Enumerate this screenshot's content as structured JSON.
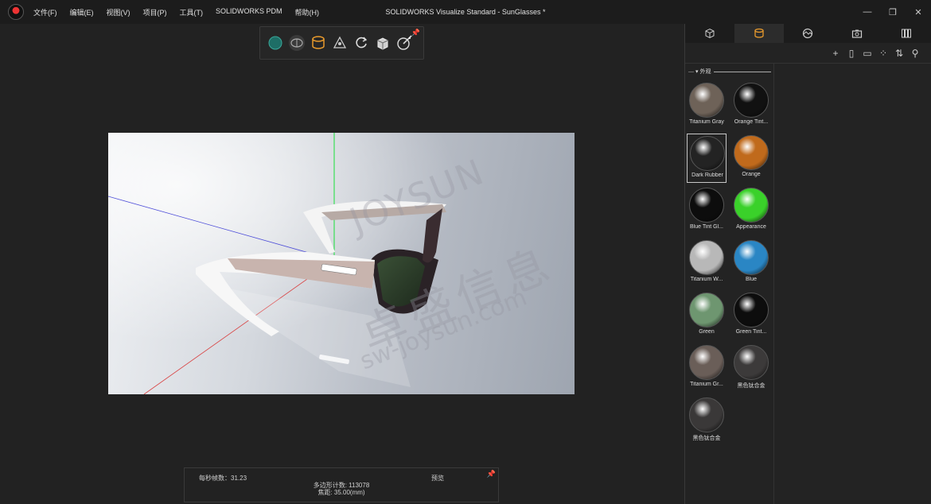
{
  "titlebar": {
    "menu": [
      "文件(F)",
      "编辑(E)",
      "视图(V)",
      "项目(P)",
      "工具(T)",
      "SOLIDWORKS PDM",
      "帮助(H)"
    ],
    "title": "SOLIDWORKS Visualize Standard - SunGlasses *",
    "controls": [
      "—",
      "❐",
      "✕"
    ]
  },
  "viewport": {
    "watermark": [
      "JOYSUN",
      "卓盛信息",
      "sw-joysun.com"
    ]
  },
  "status": {
    "fps": "每秒帧数：31.23",
    "preview": "预览",
    "polycount": "多边形计数: 113078",
    "focal": "焦距: 35.00(mm)"
  },
  "panel": {
    "section_title": "外观",
    "materials": [
      {
        "label": "Titanium Gray",
        "color": "#6e6258"
      },
      {
        "label": "Orange Tint...",
        "color": "#111111"
      },
      {
        "label": "Dark Rubber",
        "color": "#232323"
      },
      {
        "label": "Orange",
        "color": "#c06a1c"
      },
      {
        "label": "Blue Tint Gl...",
        "color": "#0d0d0d"
      },
      {
        "label": "Appearance",
        "color": "#3ad12a"
      },
      {
        "label": "Titanium W...",
        "color": "#b8b8b8"
      },
      {
        "label": "Blue",
        "color": "#2a86c4"
      },
      {
        "label": "Green",
        "color": "#6e9670"
      },
      {
        "label": "Green Tint...",
        "color": "#0d0d0d"
      },
      {
        "label": "Titanium Gr...",
        "color": "#6a5e58"
      },
      {
        "label": "黑色钛合金",
        "color": "#3c3a3a"
      },
      {
        "label": "黑色钛合金",
        "color": "#3a3838"
      }
    ]
  }
}
